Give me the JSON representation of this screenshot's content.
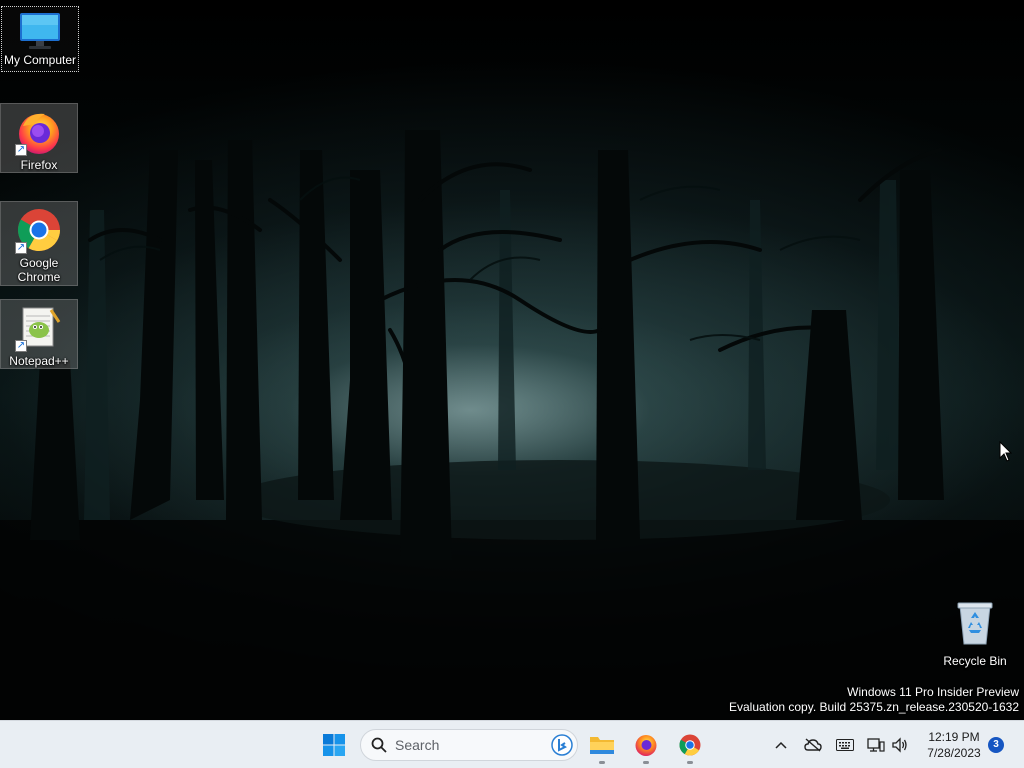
{
  "desktop": {
    "icons": [
      {
        "label": "My Computer"
      },
      {
        "label": "Firefox"
      },
      {
        "label": "Google Chrome"
      },
      {
        "label": "Notepad++"
      },
      {
        "label": "Recycle Bin"
      }
    ],
    "watermark": {
      "line1": "Windows 11 Pro Insider Preview",
      "line2": "Evaluation copy. Build 25375.zn_release.230520-1632"
    }
  },
  "taskbar": {
    "search_placeholder": "Search",
    "pinned": [
      "windows-start-icon",
      "file-explorer-icon",
      "firefox-icon",
      "chrome-icon"
    ],
    "tray": [
      "chevron-up-icon",
      "onedrive-icon",
      "keyboard-icon",
      "network-icon",
      "volume-icon"
    ],
    "time": "12:19 PM",
    "date": "7/28/2023",
    "notification_count": "3"
  },
  "colors": {
    "taskbar_bg": "#e9eef3",
    "accent": "#1656c2",
    "start_blue": "#0a7ad8"
  }
}
